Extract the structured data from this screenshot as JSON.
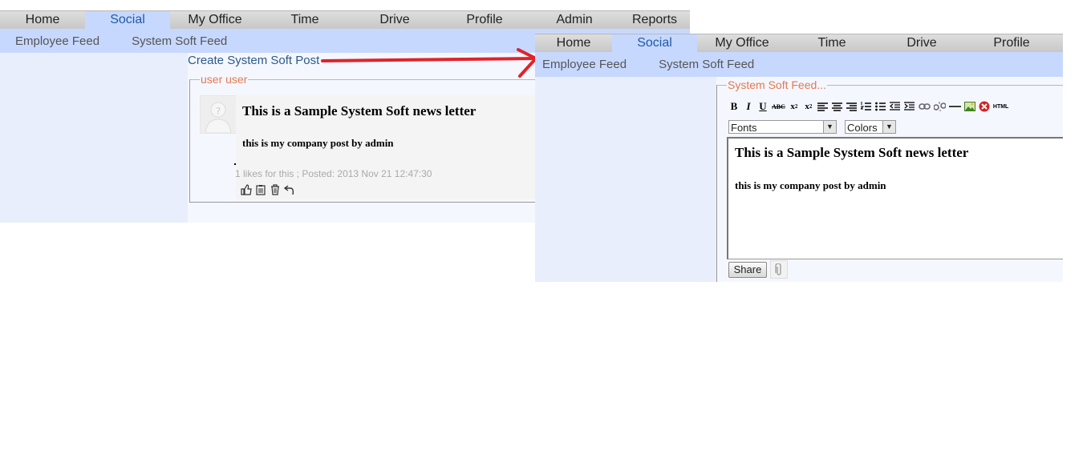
{
  "left": {
    "nav": [
      "Home",
      "Social",
      "My Office",
      "Time",
      "Drive",
      "Profile",
      "Admin",
      "Reports"
    ],
    "active_nav": "Social",
    "subnav": [
      "Employee Feed",
      "System Soft Feed"
    ],
    "create_link": "Create System Soft Post",
    "author": "user user",
    "post_title": "This is a Sample System Soft news letter",
    "post_body": "this is my company post by admin",
    "post_meta": "1 likes for this ; Posted: 2013 Nov 21 12:47:30",
    "action_icons": [
      "like-icon",
      "clipboard-icon",
      "trash-icon",
      "reply-icon"
    ]
  },
  "right": {
    "nav": [
      "Home",
      "Social",
      "My Office",
      "Time",
      "Drive",
      "Profile"
    ],
    "active_nav": "Social",
    "subnav": [
      "Employee Feed",
      "System Soft Feed"
    ],
    "composer_legend": "System Soft Feed...",
    "toolbar": {
      "bold": "B",
      "italic": "I",
      "underline": "U",
      "strike": "ABC",
      "html": "HTML"
    },
    "fonts_label": "Fonts",
    "colors_label": "Colors",
    "editor_title": "This is a Sample System Soft news letter",
    "editor_body": "this is my company post by admin",
    "share_label": "Share"
  },
  "colors": {
    "nav_active_bg": "#c7d8ff",
    "subnav_bg": "#c7d8ff",
    "legend_orange": "#e07a50",
    "arrow_red": "#e0232b",
    "link_blue": "#2a5a8a"
  }
}
